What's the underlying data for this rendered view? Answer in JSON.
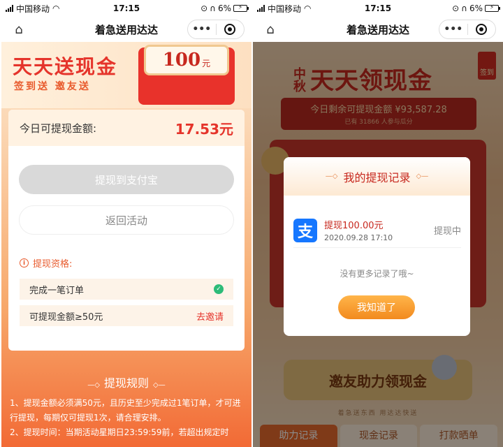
{
  "left": {
    "status": {
      "carrier": "中国移动",
      "time": "17:15",
      "battery": "6%"
    },
    "nav": {
      "title": "着急送用达达",
      "more": "•••"
    },
    "banner": {
      "title": "天天送现金",
      "subtitle": "签到送 邀友送",
      "amount": "100",
      "unit": "元"
    },
    "card": {
      "label": "今日可提现金额:",
      "amount": "17.53元",
      "withdraw_button": "提现到支付宝",
      "back_button": "返回活动",
      "qual_title": "提现资格:",
      "qual_items": [
        {
          "label": "完成一笔订单"
        },
        {
          "label": "可提现金额≥50元",
          "action": "去邀请"
        }
      ]
    },
    "rules": {
      "title": "提现规则",
      "lines": [
        "1、提现金额必须满50元，且历史至少完成过1笔订单，才可进行提现，每期仅可提现1次，请合理安排。",
        "2、提现时间：当期活动星期日23:59:59前，若超出规定时"
      ]
    }
  },
  "right": {
    "status": {
      "carrier": "中国移动",
      "time": "17:15",
      "battery": "6%"
    },
    "nav": {
      "title": "着急送用达达",
      "more": "•••"
    },
    "bg": {
      "title_small": "中秋",
      "title_big": "天天领现金",
      "sign": "签到",
      "remaining": "今日剩余可提现金额 ¥93,587.28",
      "participants": "已有 31866 人参与瓜分",
      "invite_button": "邀友助力领现金",
      "footer": "着急送东西 用达达快送",
      "tabs": [
        "助力记录",
        "现金记录",
        "打款晒单"
      ]
    },
    "modal": {
      "title": "我的提现记录",
      "record": {
        "title": "提现100.00元",
        "date": "2020.09.28 17:10",
        "status": "提现中"
      },
      "no_more": "没有更多记录了哦~",
      "ok_button": "我知道了"
    }
  }
}
